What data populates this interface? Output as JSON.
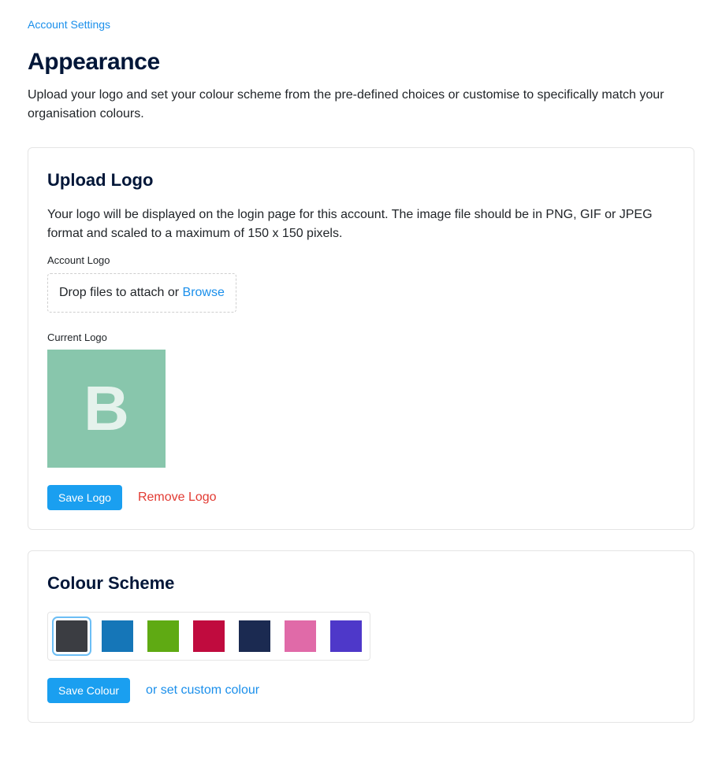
{
  "breadcrumb": "Account Settings",
  "title": "Appearance",
  "subtitle": "Upload your logo and set your colour scheme from the pre-defined choices or customise to specifically match your organisation colours.",
  "upload": {
    "heading": "Upload Logo",
    "desc": "Your logo will be displayed on the login page for this account. The image file should be in PNG, GIF or JPEG format and scaled to a maximum of 150 x 150 pixels.",
    "account_logo_label": "Account Logo",
    "drop_text": "Drop files to attach or ",
    "browse_text": "Browse",
    "current_logo_label": "Current Logo",
    "logo_letter": "B",
    "save_label": "Save Logo",
    "remove_label": "Remove Logo"
  },
  "colour": {
    "heading": "Colour Scheme",
    "swatches": [
      {
        "value": "#3b3d42",
        "selected": true
      },
      {
        "value": "#1576b8",
        "selected": false
      },
      {
        "value": "#5faa13",
        "selected": false
      },
      {
        "value": "#c00b3e",
        "selected": false
      },
      {
        "value": "#1b2a51",
        "selected": false
      },
      {
        "value": "#e06aa8",
        "selected": false
      },
      {
        "value": "#4e38c9",
        "selected": false
      }
    ],
    "save_label": "Save Colour",
    "custom_label": "or set custom colour"
  }
}
